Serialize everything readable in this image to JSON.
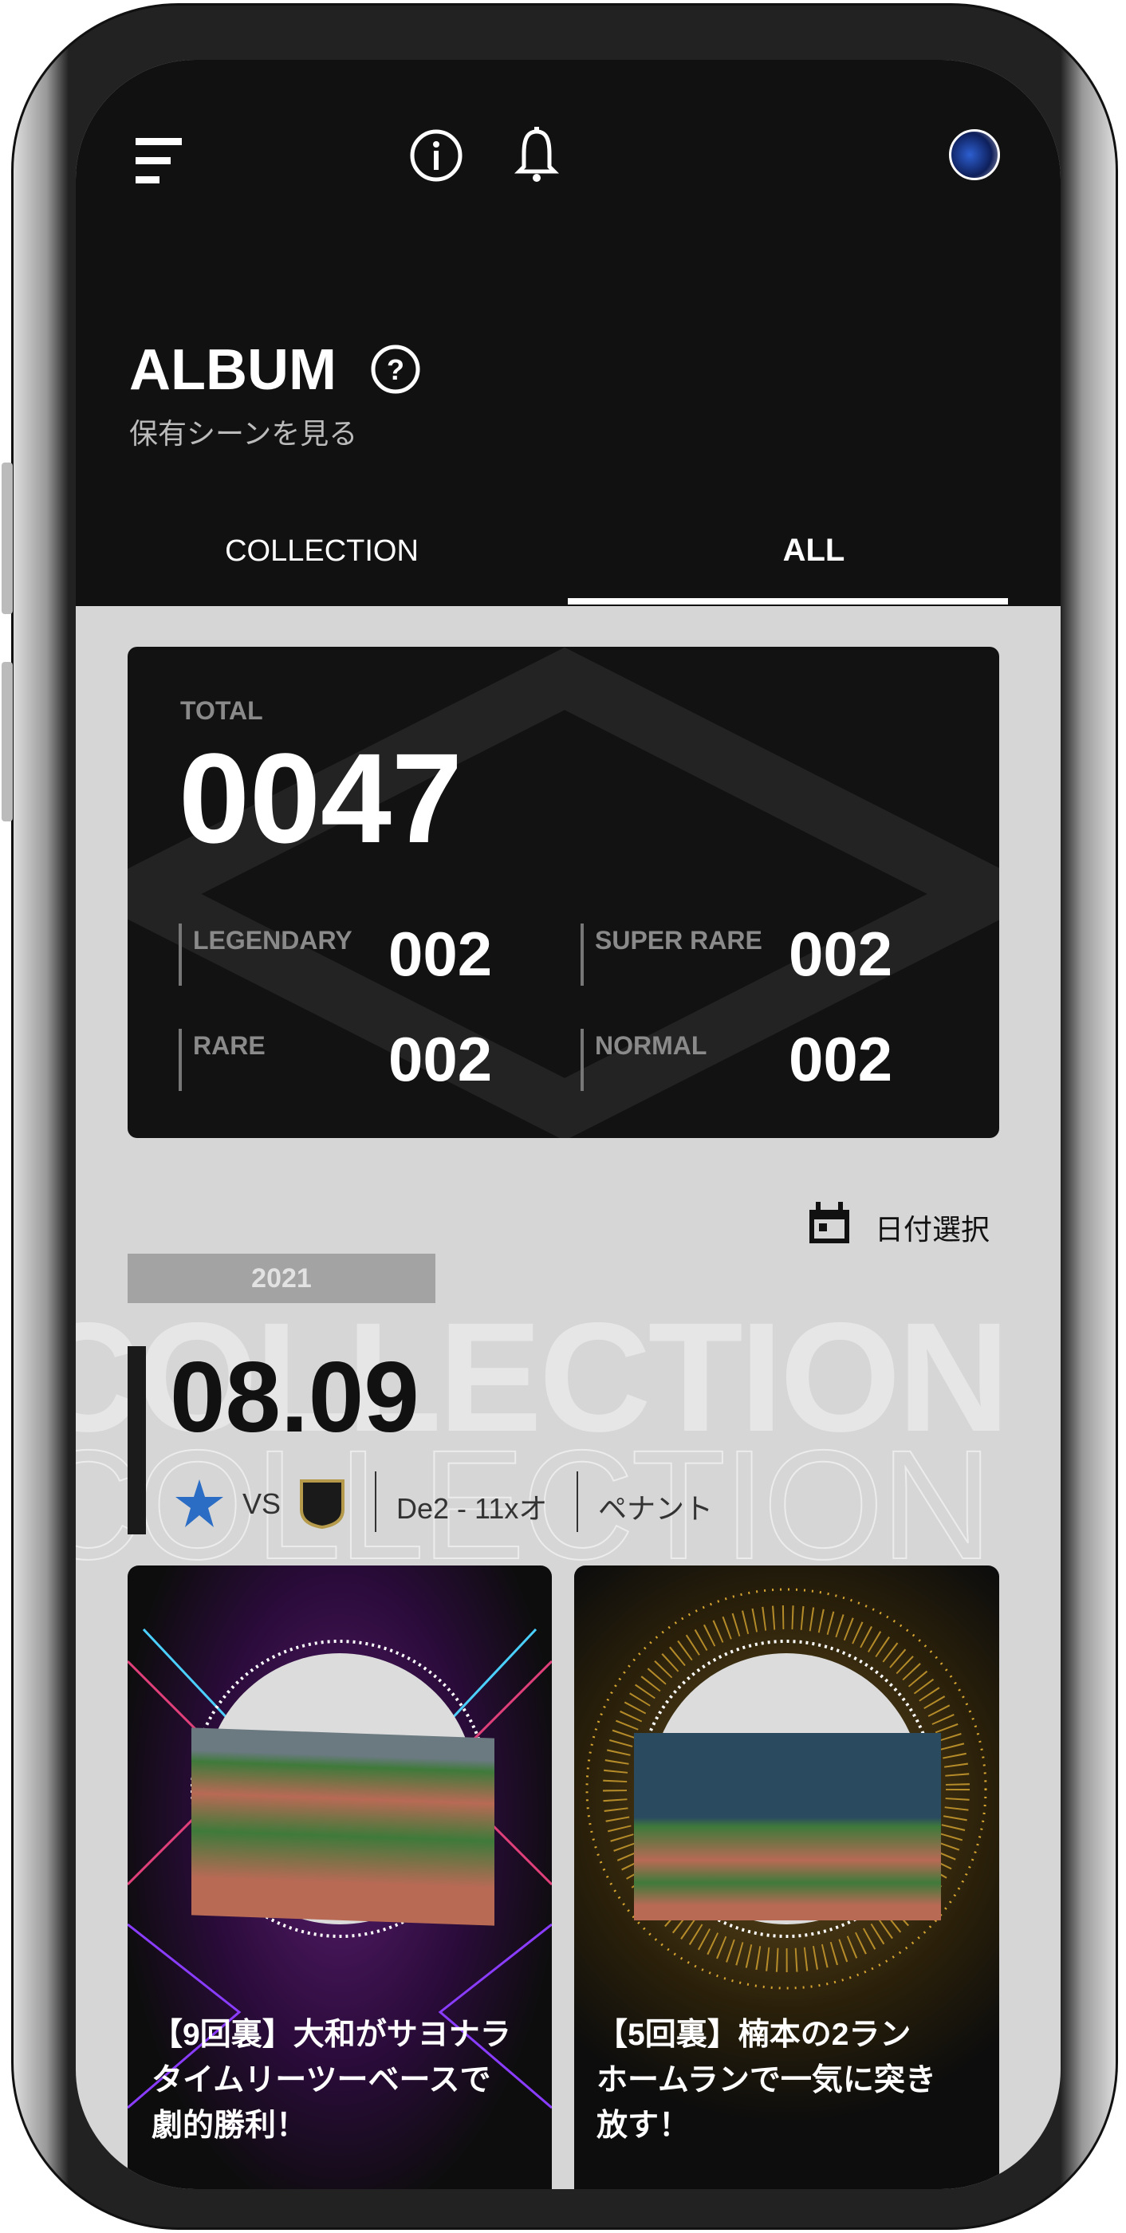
{
  "header": {
    "menu_icon": "hamburger-icon",
    "info_icon": "info-icon",
    "bell_icon": "bell-icon",
    "avatar": "user-avatar"
  },
  "page": {
    "title": "ALBUM",
    "help_icon": "question-circle-icon",
    "subtitle": "保有シーンを見る"
  },
  "tabs": [
    {
      "label": "COLLECTION",
      "active": false
    },
    {
      "label": "ALL",
      "active": true
    }
  ],
  "stats": {
    "total_label": "TOTAL",
    "total": "0047",
    "items": [
      {
        "label": "LEGENDARY",
        "value": "002"
      },
      {
        "label": "SUPER RARE",
        "value": "002"
      },
      {
        "label": "RARE",
        "value": "002"
      },
      {
        "label": "NORMAL",
        "value": "002"
      }
    ]
  },
  "date_picker": {
    "icon": "calendar-icon",
    "label": "日付選択"
  },
  "group": {
    "year": "2021",
    "watermark": "COLLECTION",
    "date": "08.09",
    "vs": "VS",
    "score": "De2 - 11xオ",
    "type": "ペナント",
    "home_team_logo": "BayStars",
    "away_team_logo": "Buffaloes"
  },
  "cards": [
    {
      "rarity": "LEGENDARY",
      "title": "【9回裏】大和がサヨナラタイムリーツーベースで劇的勝利！",
      "lines": [
        "【9回裏】大和がサヨナラ",
        "タイムリーツーベースで",
        "劇的勝利！"
      ]
    },
    {
      "rarity": "SUPER RARE",
      "title": "【5回裏】楠本の2ランホームランで一気に突き放す！",
      "lines": [
        "【5回裏】楠本の2ラン",
        "ホームランで一気に突き",
        "放す！"
      ]
    }
  ],
  "colors": {
    "dark": "#111111",
    "bg": "#d6d6d6",
    "year_bar": "#a3a3a3",
    "legendary_accent": "#c03cff",
    "super_rare_accent": "#d6a531"
  }
}
